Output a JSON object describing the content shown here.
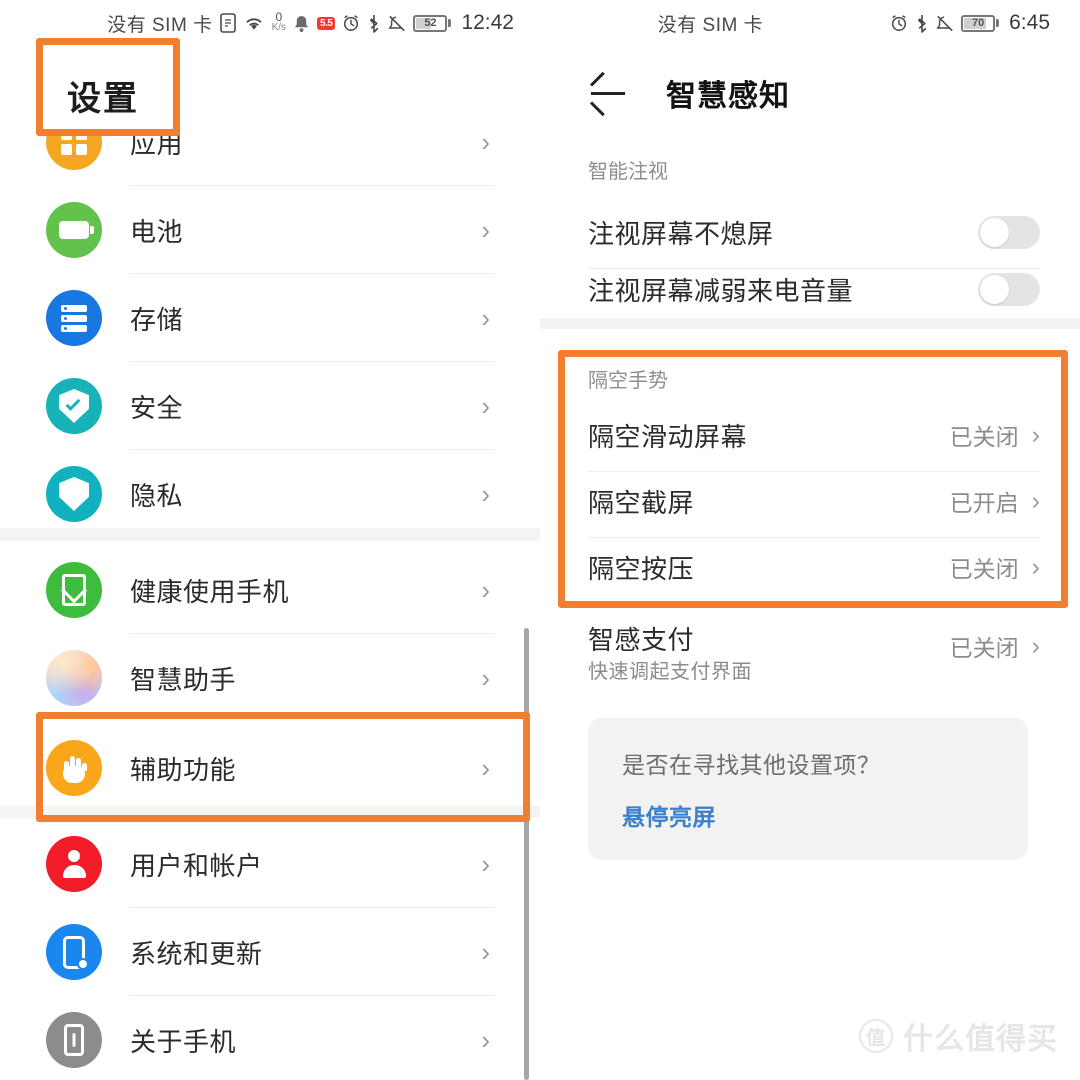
{
  "left": {
    "statusbar": {
      "sim": "没有 SIM 卡",
      "netspeed_value": "0",
      "netspeed_unit": "K/s",
      "battery_percent": "52",
      "time": "12:42",
      "icons": [
        "wifi-icon",
        "netspeed-icon",
        "bell-icon",
        "red-badge-icon",
        "alarm-icon",
        "bluetooth-icon",
        "mute-icon",
        "battery-icon"
      ]
    },
    "title": "设置",
    "items": [
      {
        "label": "应用",
        "icon": "apps-icon",
        "color": "#F5A623",
        "chevron": "›"
      },
      {
        "label": "电池",
        "icon": "battery-icon",
        "color": "#62C24D",
        "chevron": "›"
      },
      {
        "label": "存储",
        "icon": "storage-icon",
        "color": "#1878E0",
        "chevron": "›"
      },
      {
        "label": "安全",
        "icon": "shield-check-icon",
        "color": "#17B3B8",
        "chevron": "›"
      },
      {
        "label": "隐私",
        "icon": "privacy-shield-icon",
        "color": "#12B1C0",
        "chevron": "›"
      },
      {
        "label": "健康使用手机",
        "icon": "hourglass-icon",
        "color": "#3DBC3D",
        "chevron": "›"
      },
      {
        "label": "智慧助手",
        "icon": "assistant-gradient-icon",
        "color": "#E0C4EF",
        "chevron": "›"
      },
      {
        "label": "辅助功能",
        "icon": "hand-icon",
        "color": "#FAA61A",
        "chevron": "›"
      },
      {
        "label": "用户和帐户",
        "icon": "user-account-icon",
        "color": "#F21D28",
        "chevron": "›"
      },
      {
        "label": "系统和更新",
        "icon": "system-update-icon",
        "color": "#1A87EF",
        "chevron": "›"
      },
      {
        "label": "关于手机",
        "icon": "about-phone-icon",
        "color": "#8C8C8C",
        "chevron": "›"
      }
    ]
  },
  "right": {
    "statusbar": {
      "sim": "没有 SIM 卡",
      "battery_percent": "70",
      "time": "6:45",
      "icons": [
        "alarm-icon",
        "bluetooth-icon",
        "mute-icon",
        "battery-icon"
      ]
    },
    "appbar": {
      "back": "back-arrow-icon",
      "title": "智慧感知"
    },
    "section1": {
      "header": "智能注视",
      "rows": [
        {
          "label": "注视屏幕不熄屏",
          "toggle": "off"
        },
        {
          "label": "注视屏幕减弱来电音量",
          "toggle": "off"
        }
      ]
    },
    "section2": {
      "header": "隔空手势",
      "rows": [
        {
          "label": "隔空滑动屏幕",
          "value": "已关闭",
          "chevron": "›"
        },
        {
          "label": "隔空截屏",
          "value": "已开启",
          "chevron": "›"
        },
        {
          "label": "隔空按压",
          "value": "已关闭",
          "chevron": "›"
        }
      ]
    },
    "payment": {
      "label": "智感支付",
      "sub": "快速调起支付界面",
      "value": "已关闭",
      "chevron": "›"
    },
    "tip": {
      "question": "是否在寻找其他设置项？",
      "link": "悬停亮屏"
    }
  },
  "watermark": {
    "mark": "值",
    "text": "什么值得买"
  },
  "accent": {
    "highlight": "#F08030"
  }
}
